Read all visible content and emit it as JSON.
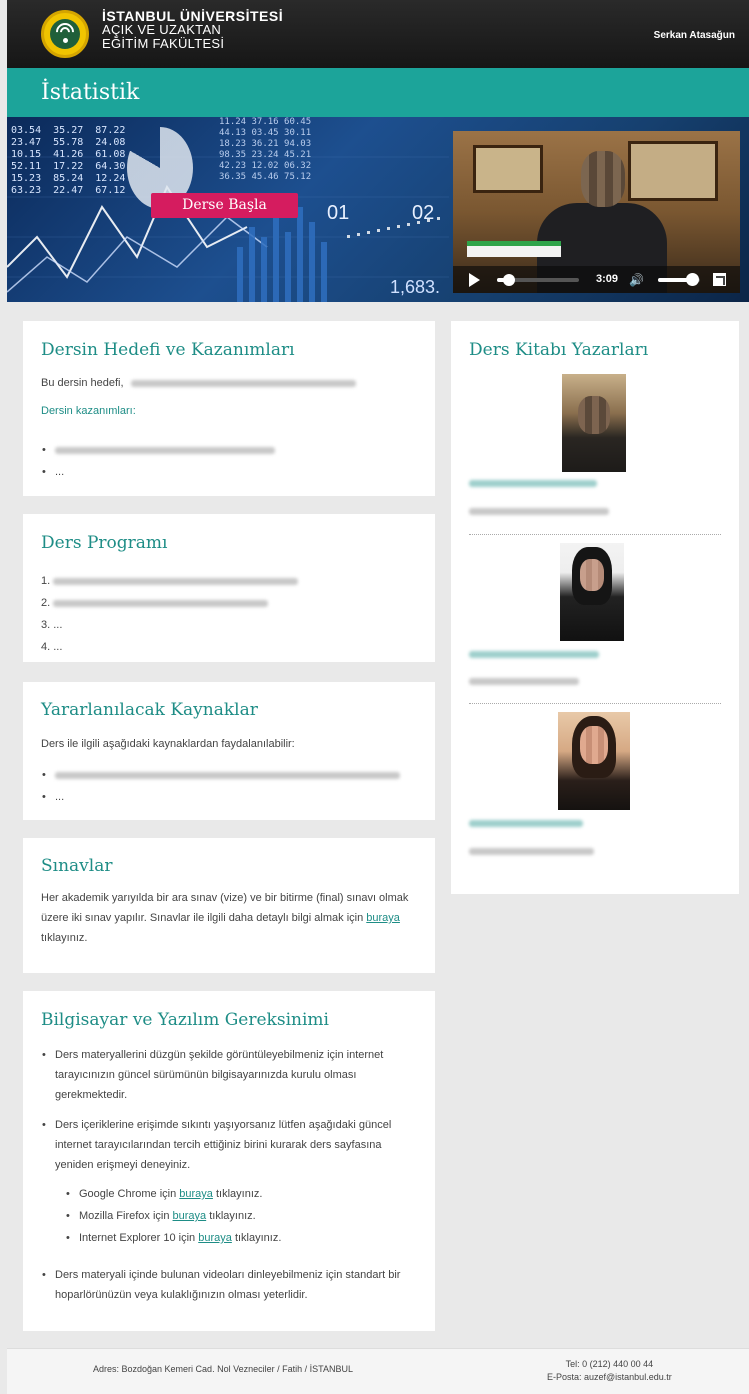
{
  "header": {
    "org_line1": "İSTANBUL ÜNİVERSİTESİ",
    "org_line2": "AÇIK VE UZAKTAN",
    "org_line3": "EĞİTİM FAKÜLTESİ",
    "user_name": "Serkan Atasağun"
  },
  "page_title": "İstatistik",
  "banner": {
    "numbers_left": "03.54  35.27  87.22\n23.47  55.78  24.08\n10.15  41.26  61.08\n52.11  17.22  64.30\n15.23  85.24  12.24\n63.23  22.47  67.12",
    "numbers_top": "11.24 37.16 60.45\n44.13 03.45 30.11\n18.23 36.21 94.03\n98.35 23.24 45.21\n42.23 12.02 06.32\n36.35 45.46 75.12",
    "label_01": "01",
    "label_02": "02",
    "label_bottom": "1,683.",
    "start_button": "Derse Başla"
  },
  "video": {
    "time": "3:09",
    "progress": 0.15,
    "volume": 0.8
  },
  "goals": {
    "title": "Dersin Hedefi ve Kazanımları",
    "intro": "Bu dersin hedefi,",
    "outcomes_label": "Dersin kazanımları:",
    "item_more": "..."
  },
  "program": {
    "title": "Ders Programı",
    "n1": "1.",
    "n2": "2.",
    "n3": "3. ...",
    "n4": "4. ..."
  },
  "resources": {
    "title": "Yararlanılacak Kaynaklar",
    "intro": "Ders ile ilgili aşağıdaki kaynaklardan faydalanılabilir:",
    "item_more": "..."
  },
  "exams": {
    "title": "Sınavlar",
    "text": "Her akademik yarıyılda bir ara sınav (vize) ve bir bitirme (final) sınavı olmak üzere iki sınav yapılır. Sınavlar ile ilgili daha detaylı bilgi almak için",
    "link": "buraya",
    "after_link": "tıklayınız."
  },
  "requirements": {
    "title": "Bilgisayar ve Yazılım Gereksinimi",
    "item1": "Ders materyallerini düzgün şekilde görüntüleyebilmeniz için internet tarayıcınızın güncel sürümünün bilgisayarınızda kurulu olması gerekmektedir.",
    "item2": "Ders içeriklerine erişimde sıkıntı yaşıyorsanız lütfen aşağıdaki güncel internet tarayıcılarından tercih ettiğiniz birini kurarak ders sayfasına yeniden erişmeyi deneyiniz.",
    "browsers": [
      {
        "prefix": "Google Chrome için",
        "link": "buraya",
        "suffix": "tıklayınız."
      },
      {
        "prefix": "Mozilla Firefox için",
        "link": "buraya",
        "suffix": "tıklayınız."
      },
      {
        "prefix": "Internet Explorer 10 için",
        "link": "buraya",
        "suffix": "tıklayınız."
      }
    ],
    "item3": "Ders materyali içinde bulunan videoları dinleyebilmeniz için standart bir hoparlörünüzün veya kulaklığınızın olması yeterlidir."
  },
  "authors": {
    "title": "Ders Kitabı Yazarları"
  },
  "footer": {
    "address": "Adres: Bozdoğan Kemeri Cad. Nol Vezneciler / Fatih / İSTANBUL",
    "tel": "Tel: 0 (212) 440 00 44",
    "email": "E-Posta: auzef@istanbul.edu.tr"
  },
  "colors": {
    "accent": "#1ca49a",
    "heading": "#1e8d86",
    "button": "#d51c5f",
    "header_bg": "#1e1e1e"
  }
}
